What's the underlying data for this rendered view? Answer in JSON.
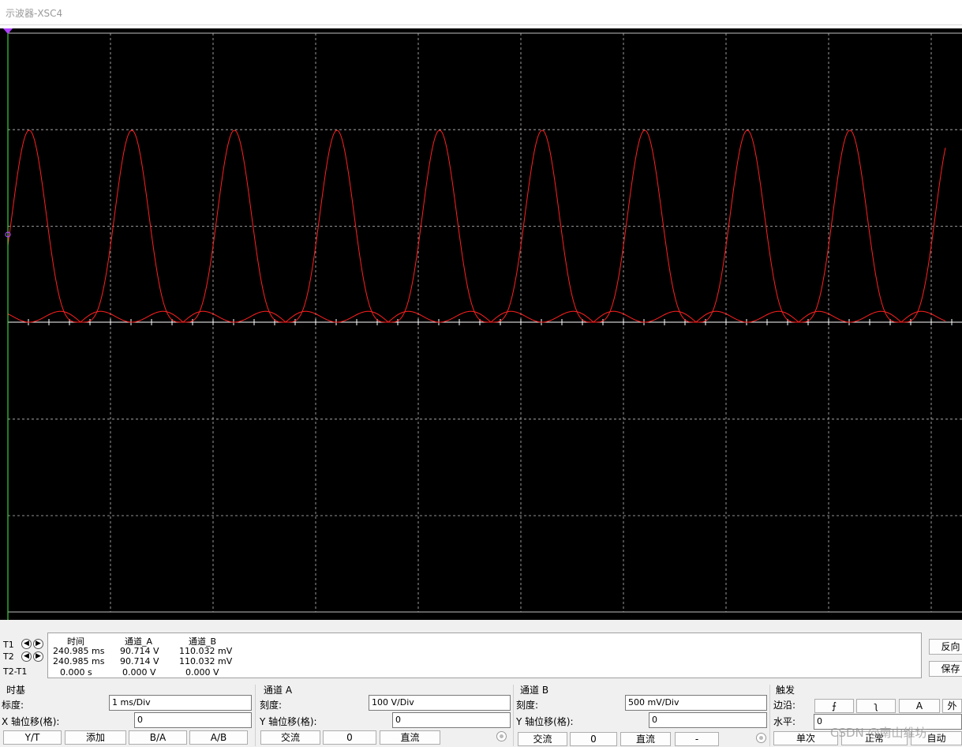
{
  "window": {
    "title": "示波器-XSC4"
  },
  "scope": {
    "background": "#000000",
    "trace_color": "#ff2020",
    "grid_color": "#bfbfbf",
    "cursor_color": "#3ad33a",
    "cursor_marker_color": "#b040ff"
  },
  "readout": {
    "rows": {
      "t1": "T1",
      "t2": "T2",
      "t2t1": "T2-T1"
    },
    "headers": {
      "time": "时间",
      "channel_a": "通道_A",
      "channel_b": "通道_B"
    },
    "t1": {
      "time": "240.985 ms",
      "channel_a": "90.714 V",
      "channel_b": "110.032 mV"
    },
    "t2": {
      "time": "240.985 ms",
      "channel_a": "90.714 V",
      "channel_b": "110.032 mV"
    },
    "t2t1": {
      "time": "0.000 s",
      "channel_a": "0.000 V",
      "channel_b": "0.000 V"
    },
    "side_buttons": {
      "reverse": "反向",
      "save": "保存"
    }
  },
  "timebase": {
    "title": "时基",
    "scale_label": "标度:",
    "scale_value": "1 ms/Div",
    "x_pos_label": "X 轴位移(格):",
    "x_pos_value": "0",
    "buttons": {
      "yt": "Y/T",
      "add": "添加",
      "ba": "B/A",
      "ab": "A/B"
    }
  },
  "channel_a": {
    "title": "通道 A",
    "scale_label": "刻度:",
    "scale_value": "100  V/Div",
    "y_pos_label": "Y 轴位移(格):",
    "y_pos_value": "0",
    "buttons": {
      "ac": "交流",
      "zero": "0",
      "dc": "直流"
    }
  },
  "channel_b": {
    "title": "通道 B",
    "scale_label": "刻度:",
    "scale_value": "500 mV/Div",
    "y_pos_label": "Y 轴位移(格):",
    "y_pos_value": "0",
    "buttons": {
      "ac": "交流",
      "zero": "0",
      "dc": "直流",
      "minus": "-"
    }
  },
  "trigger": {
    "title": "触发",
    "edge_label": "边沿:",
    "edge_buttons": {
      "rising": "⨍",
      "falling": "ʅ",
      "a": "A",
      "ext": "外"
    },
    "level_label": "水平:",
    "level_value": "0",
    "buttons": {
      "single": "单次",
      "normal": "正常",
      "auto": "自动"
    }
  },
  "watermark": "CSDN @南山维坊"
}
